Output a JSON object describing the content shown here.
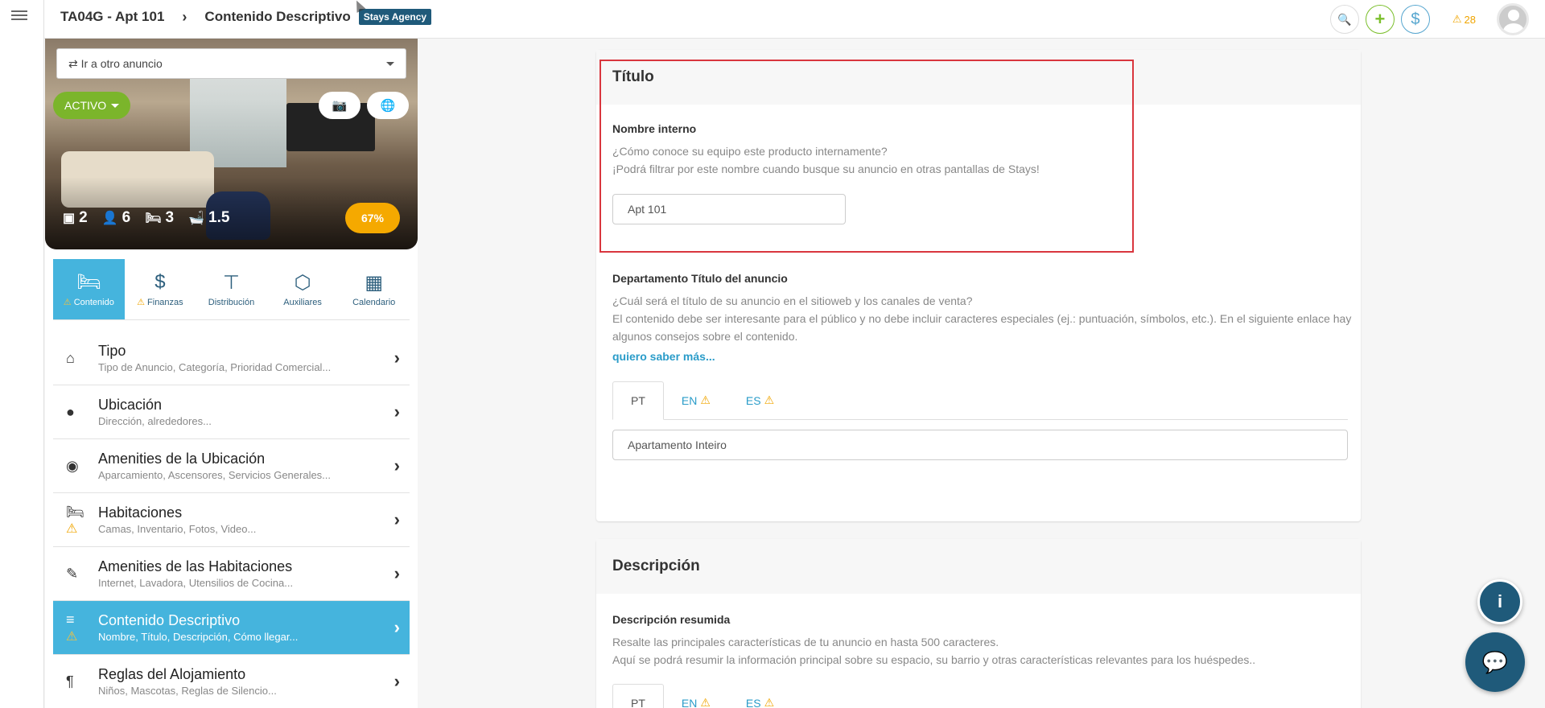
{
  "header": {
    "property_code": "TA04G - Apt 101",
    "separator": "›",
    "page_title": "Contenido Descriptivo",
    "agency_badge": "Stays Agency",
    "alert_count": "28",
    "alert_icon": "⚠",
    "search_icon": "🔍",
    "add_icon": "+",
    "money_icon": "$"
  },
  "property": {
    "go_to_placeholder": "⇄ Ir a otro anuncio",
    "status": "ACTIVO",
    "camera_icon": "📷",
    "globe_icon": "🌐",
    "stats": {
      "units": "2",
      "guests": "6",
      "beds": "3",
      "baths": "1.5"
    },
    "stat_icons": {
      "units": "▣",
      "guests": "👤",
      "beds": "🛏",
      "baths": "🛁"
    },
    "completion": "67%"
  },
  "tabs": [
    {
      "label": "Contenido",
      "icon": "🛏",
      "warn": true,
      "active": true
    },
    {
      "label": "Finanzas",
      "icon": "$",
      "warn": true,
      "active": false
    },
    {
      "label": "Distribución",
      "icon": "⊤",
      "warn": false,
      "active": false
    },
    {
      "label": "Auxiliares",
      "icon": "⬡",
      "warn": false,
      "active": false
    },
    {
      "label": "Calendario",
      "icon": "▦",
      "warn": false,
      "active": false
    }
  ],
  "menu": [
    {
      "title": "Tipo",
      "subtitle": "Tipo de Anuncio, Categoría, Prioridad Comercial...",
      "icon": "⌂",
      "warn": false
    },
    {
      "title": "Ubicación",
      "subtitle": "Dirección, alrededores...",
      "icon": "●",
      "warn": false
    },
    {
      "title": "Amenities de la Ubicación",
      "subtitle": "Aparcamiento, Ascensores, Servicios Generales...",
      "icon": "◉",
      "warn": false
    },
    {
      "title": "Habitaciones",
      "subtitle": "Camas, Inventario, Fotos, Video...",
      "icon": "🛏",
      "warn": true
    },
    {
      "title": "Amenities de las Habitaciones",
      "subtitle": "Internet, Lavadora, Utensilios de Cocina...",
      "icon": "✎",
      "warn": false
    },
    {
      "title": "Contenido Descriptivo",
      "subtitle": "Nombre, Título, Descripción, Cómo llegar...",
      "icon": "≡",
      "warn": true
    },
    {
      "title": "Reglas del Alojamiento",
      "subtitle": "Niños, Mascotas, Reglas de Silencio...",
      "icon": "¶",
      "warn": false
    }
  ],
  "menu_chevron": "›",
  "warn_icon": "⚠",
  "titulo_card": {
    "heading": "Título",
    "internal_name_label": "Nombre interno",
    "internal_name_help_1": "¿Cómo conoce su equipo este producto internamente?",
    "internal_name_help_2": "¡Podrá filtrar por este nombre cuando busque su anuncio en otras pantallas de Stays!",
    "internal_name_value": "Apt 101",
    "listing_title_label": "Departamento Título del anuncio",
    "listing_title_help_1": "¿Cuál será el título de su anuncio en el sitioweb y los canales de venta?",
    "listing_title_help_2": "El contenido debe ser interesante para el público y no debe incluir caracteres especiales (ej.: puntuación, símbolos, etc.). En el siguiente enlace hay algunos consejos sobre el contenido.",
    "learn_more": "quiero saber más...",
    "languages": [
      {
        "code": "PT",
        "warn": false,
        "active": true
      },
      {
        "code": "EN",
        "warn": true,
        "active": false
      },
      {
        "code": "ES",
        "warn": true,
        "active": false
      }
    ],
    "listing_title_value": "Apartamento Inteiro"
  },
  "descripcion_card": {
    "heading": "Descripción",
    "summary_label": "Descripción resumida",
    "summary_help_1": "Resalte las principales características de tu anuncio en hasta 500 caracteres.",
    "summary_help_2": "Aquí se podrá resumir la información principal sobre su espacio, su barrio y otras características relevantes para los huéspedes..",
    "languages": [
      {
        "code": "PT",
        "warn": false,
        "active": true
      },
      {
        "code": "EN",
        "warn": true,
        "active": false
      },
      {
        "code": "ES",
        "warn": true,
        "active": false
      }
    ]
  },
  "fab": {
    "info_icon": "i",
    "chat_icon": "💬"
  }
}
